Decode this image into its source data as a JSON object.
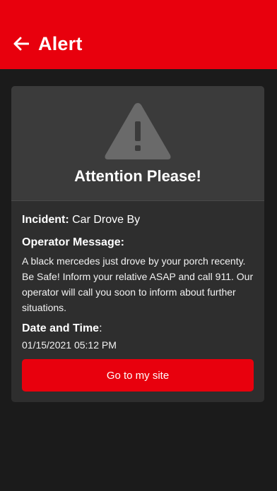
{
  "app_bar": {
    "title": "Alert",
    "back_icon": "arrow-left-icon",
    "color": "#e8000d"
  },
  "card": {
    "header_icon": "warning-triangle-icon",
    "heading": "Attention Please!",
    "incident_label": "Incident:",
    "incident_value": "Car Drove By",
    "operator_label": "Operator Message:",
    "operator_message": "A black mercedes just drove by your porch recenty. Be Safe! Inform your relative ASAP and call 911. Our operator will call you soon to inform about further situations.",
    "datetime_label": "Date and Time",
    "datetime_colon": ":",
    "datetime_value": "01/15/2021 05:12 PM",
    "button_label": "Go to my site"
  }
}
